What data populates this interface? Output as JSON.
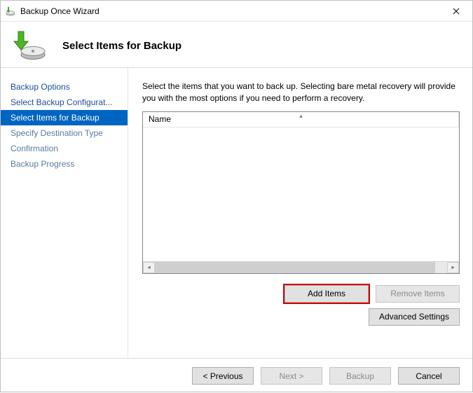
{
  "window": {
    "title": "Backup Once Wizard"
  },
  "header": {
    "heading": "Select Items for Backup"
  },
  "sidebar": {
    "steps": [
      {
        "label": "Backup Options",
        "state": "done"
      },
      {
        "label": "Select Backup Configurat...",
        "state": "done"
      },
      {
        "label": "Select Items for Backup",
        "state": "current"
      },
      {
        "label": "Specify Destination Type",
        "state": "future"
      },
      {
        "label": "Confirmation",
        "state": "future"
      },
      {
        "label": "Backup Progress",
        "state": "future"
      }
    ]
  },
  "main": {
    "instruction": "Select the items that you want to back up. Selecting bare metal recovery will provide you with the most options if you need to perform a recovery.",
    "list": {
      "column_header": "Name",
      "items": []
    },
    "buttons": {
      "add_items": "Add Items",
      "remove_items": "Remove Items",
      "advanced_settings": "Advanced Settings"
    }
  },
  "footer": {
    "previous": "< Previous",
    "next": "Next >",
    "backup": "Backup",
    "cancel": "Cancel"
  }
}
